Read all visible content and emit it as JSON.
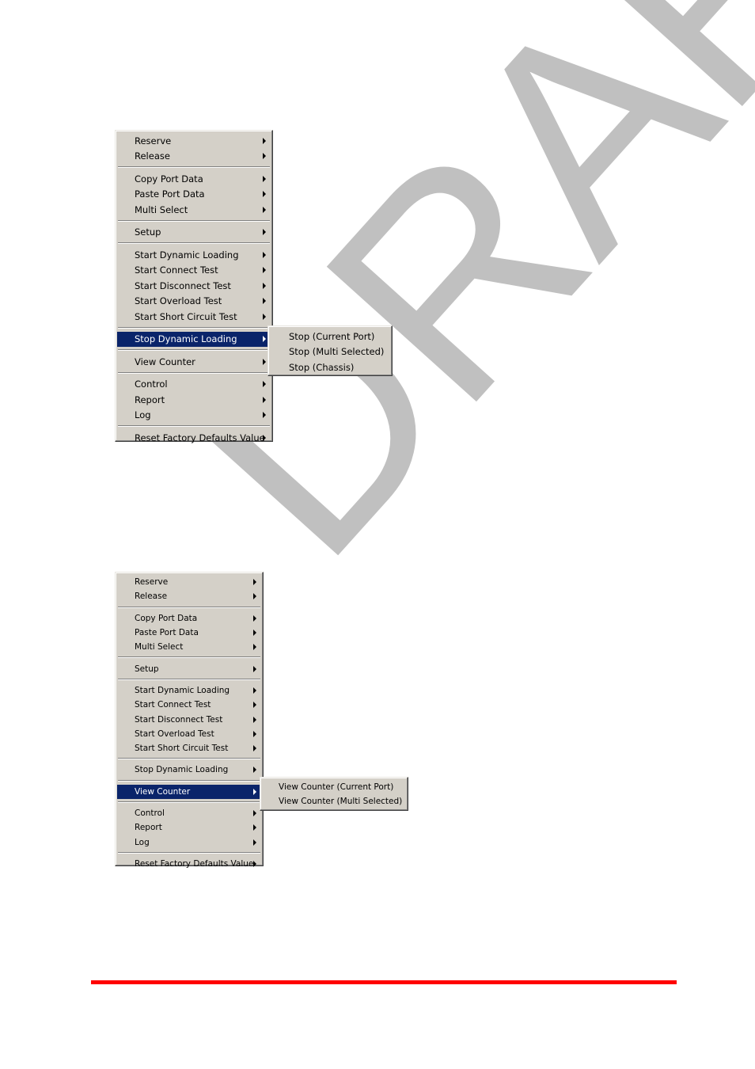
{
  "watermark": {
    "text": "DRAFT",
    "color": "#c0c0c0"
  },
  "colors": {
    "menu_bg": "#d4d0c8",
    "highlight_bg": "#0a246a",
    "highlight_fg": "#ffffff",
    "footer_rule": "#ff0000"
  },
  "figure1": {
    "menu": {
      "groups": [
        [
          {
            "label": "Reserve"
          },
          {
            "label": "Release"
          }
        ],
        [
          {
            "label": "Copy Port Data"
          },
          {
            "label": "Paste Port Data"
          },
          {
            "label": "Multi Select"
          }
        ],
        [
          {
            "label": "Setup"
          }
        ],
        [
          {
            "label": "Start Dynamic Loading"
          },
          {
            "label": "Start Connect Test"
          },
          {
            "label": "Start Disconnect Test"
          },
          {
            "label": "Start Overload Test"
          },
          {
            "label": "Start Short Circuit Test"
          }
        ],
        [
          {
            "label": "Stop Dynamic Loading",
            "highlighted": true
          }
        ],
        [
          {
            "label": "View Counter"
          }
        ],
        [
          {
            "label": "Control"
          },
          {
            "label": "Report"
          },
          {
            "label": "Log"
          }
        ],
        [
          {
            "label": "Reset Factory Defaults Value"
          }
        ]
      ]
    },
    "submenu": {
      "parent": "Stop Dynamic Loading",
      "items": [
        {
          "label": "Stop (Current Port)"
        },
        {
          "label": "Stop (Multi Selected)"
        },
        {
          "label": "Stop (Chassis)"
        }
      ]
    }
  },
  "figure2": {
    "menu": {
      "groups": [
        [
          {
            "label": "Reserve"
          },
          {
            "label": "Release"
          }
        ],
        [
          {
            "label": "Copy Port Data"
          },
          {
            "label": "Paste Port Data"
          },
          {
            "label": "Multi Select"
          }
        ],
        [
          {
            "label": "Setup"
          }
        ],
        [
          {
            "label": "Start Dynamic Loading"
          },
          {
            "label": "Start Connect Test"
          },
          {
            "label": "Start Disconnect Test"
          },
          {
            "label": "Start Overload Test"
          },
          {
            "label": "Start Short Circuit Test"
          }
        ],
        [
          {
            "label": "Stop Dynamic Loading"
          }
        ],
        [
          {
            "label": "View Counter",
            "highlighted": true
          }
        ],
        [
          {
            "label": "Control"
          },
          {
            "label": "Report"
          },
          {
            "label": "Log"
          }
        ],
        [
          {
            "label": "Reset Factory Defaults Value"
          }
        ]
      ]
    },
    "submenu": {
      "parent": "View Counter",
      "items": [
        {
          "label": "View Counter (Current Port)"
        },
        {
          "label": "View Counter (Multi Selected)"
        }
      ]
    }
  }
}
